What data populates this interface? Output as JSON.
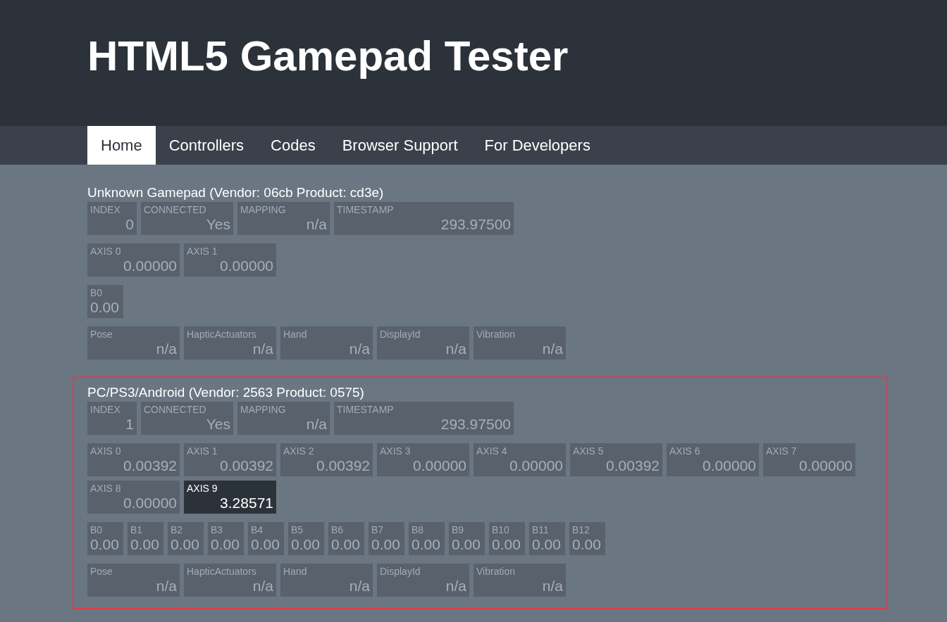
{
  "site_title": "HTML5 Gamepad Tester",
  "nav": [
    {
      "label": "Home",
      "selected": true
    },
    {
      "label": "Controllers",
      "selected": false
    },
    {
      "label": "Codes",
      "selected": false
    },
    {
      "label": "Browser Support",
      "selected": false
    },
    {
      "label": "For Developers",
      "selected": false
    }
  ],
  "gamepads": [
    {
      "title": "Unknown Gamepad (Vendor: 06cb Product: cd3e)",
      "highlighted": false,
      "info": [
        {
          "label": "INDEX",
          "value": "0",
          "kind": "small"
        },
        {
          "label": "CONNECTED",
          "value": "Yes",
          "kind": "medium"
        },
        {
          "label": "MAPPING",
          "value": "n/a",
          "kind": "medium"
        },
        {
          "label": "TIMESTAMP",
          "value": "293.97500",
          "kind": "wide"
        }
      ],
      "axes": [
        {
          "label": "AXIS 0",
          "value": "0.00000",
          "active": false
        },
        {
          "label": "AXIS 1",
          "value": "0.00000",
          "active": false
        }
      ],
      "buttons": [
        {
          "label": "B0",
          "value": "0.00"
        }
      ],
      "extras": [
        {
          "label": "Pose",
          "value": "n/a"
        },
        {
          "label": "HapticActuators",
          "value": "n/a"
        },
        {
          "label": "Hand",
          "value": "n/a"
        },
        {
          "label": "DisplayId",
          "value": "n/a"
        },
        {
          "label": "Vibration",
          "value": "n/a"
        }
      ]
    },
    {
      "title": "PC/PS3/Android (Vendor: 2563 Product: 0575)",
      "highlighted": true,
      "info": [
        {
          "label": "INDEX",
          "value": "1",
          "kind": "small"
        },
        {
          "label": "CONNECTED",
          "value": "Yes",
          "kind": "medium"
        },
        {
          "label": "MAPPING",
          "value": "n/a",
          "kind": "medium"
        },
        {
          "label": "TIMESTAMP",
          "value": "293.97500",
          "kind": "wide"
        }
      ],
      "axes": [
        {
          "label": "AXIS 0",
          "value": "0.00392",
          "active": false
        },
        {
          "label": "AXIS 1",
          "value": "0.00392",
          "active": false
        },
        {
          "label": "AXIS 2",
          "value": "0.00392",
          "active": false
        },
        {
          "label": "AXIS 3",
          "value": "0.00000",
          "active": false
        },
        {
          "label": "AXIS 4",
          "value": "0.00000",
          "active": false
        },
        {
          "label": "AXIS 5",
          "value": "0.00392",
          "active": false
        },
        {
          "label": "AXIS 6",
          "value": "0.00000",
          "active": false
        },
        {
          "label": "AXIS 7",
          "value": "0.00000",
          "active": false
        },
        {
          "label": "AXIS 8",
          "value": "0.00000",
          "active": false
        },
        {
          "label": "AXIS 9",
          "value": "3.28571",
          "active": true
        }
      ],
      "buttons": [
        {
          "label": "B0",
          "value": "0.00"
        },
        {
          "label": "B1",
          "value": "0.00"
        },
        {
          "label": "B2",
          "value": "0.00"
        },
        {
          "label": "B3",
          "value": "0.00"
        },
        {
          "label": "B4",
          "value": "0.00"
        },
        {
          "label": "B5",
          "value": "0.00"
        },
        {
          "label": "B6",
          "value": "0.00"
        },
        {
          "label": "B7",
          "value": "0.00"
        },
        {
          "label": "B8",
          "value": "0.00"
        },
        {
          "label": "B9",
          "value": "0.00"
        },
        {
          "label": "B10",
          "value": "0.00"
        },
        {
          "label": "B11",
          "value": "0.00"
        },
        {
          "label": "B12",
          "value": "0.00"
        }
      ],
      "extras": [
        {
          "label": "Pose",
          "value": "n/a"
        },
        {
          "label": "HapticActuators",
          "value": "n/a"
        },
        {
          "label": "Hand",
          "value": "n/a"
        },
        {
          "label": "DisplayId",
          "value": "n/a"
        },
        {
          "label": "Vibration",
          "value": "n/a"
        }
      ]
    }
  ]
}
